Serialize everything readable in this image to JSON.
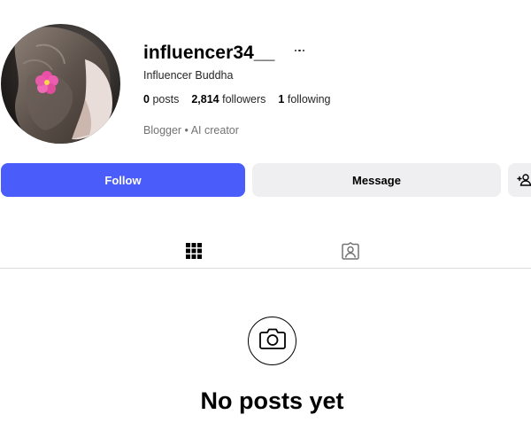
{
  "profile": {
    "username": "influencer34__",
    "full_name": "Influencer Buddha",
    "bio": "Blogger • AI creator",
    "avatar_icon": "profile-photo"
  },
  "stats": {
    "posts_count": "0",
    "posts_label": "posts",
    "followers_count": "2,814",
    "followers_label": "followers",
    "following_count": "1",
    "following_label": "following"
  },
  "actions": {
    "follow_label": "Follow",
    "message_label": "Message",
    "suggest_icon": "add-person-icon"
  },
  "tabs": [
    {
      "icon": "grid-icon",
      "active": true
    },
    {
      "icon": "tagged-icon",
      "active": false
    }
  ],
  "empty_state": {
    "icon": "camera-icon",
    "title": "No posts yet"
  },
  "colors": {
    "accent": "#4a5dfa",
    "secondary_button": "#efeff1",
    "muted_text": "#737373",
    "divider": "#dbdbdb"
  }
}
